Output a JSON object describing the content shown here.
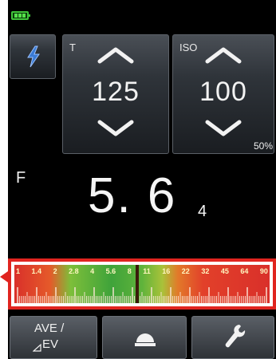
{
  "shutter": {
    "label": "T",
    "value": "125"
  },
  "iso": {
    "label": "ISO",
    "value": "100"
  },
  "flash_output_percent": "50%",
  "aperture": {
    "label": "F",
    "value": "5. 6",
    "tenths": "4"
  },
  "scale": {
    "stops": [
      "1",
      "1.4",
      "2",
      "2.8",
      "4",
      "5.6",
      "8",
      "11",
      "16",
      "22",
      "32",
      "45",
      "64",
      "90"
    ],
    "measured_stop": "5.6"
  },
  "bottom_buttons": {
    "ave_line1": "AVE /",
    "ave_line2": "EV"
  },
  "colors": {
    "battery": "#3fc33a",
    "scale_border": "#e0241f",
    "scale_green": "#3fa33a",
    "scale_red": "#d9302a"
  },
  "icons": {
    "battery": "battery-icon",
    "flash": "flash-bolt-icon",
    "up": "chevron-up-icon",
    "down": "chevron-down-icon",
    "mode": "dome-receptor-icon",
    "settings": "wrench-icon"
  }
}
